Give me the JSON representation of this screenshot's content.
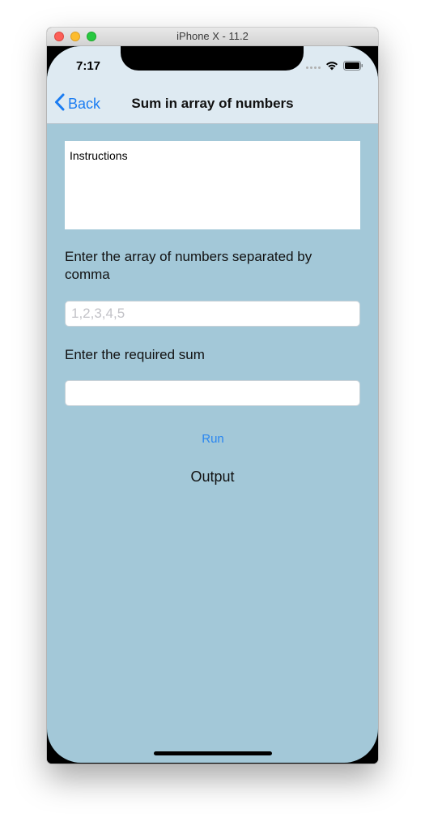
{
  "window": {
    "title": "iPhone X - 11.2"
  },
  "status_bar": {
    "time": "7:17"
  },
  "nav": {
    "back_label": "Back",
    "title": "Sum in array of numbers"
  },
  "instructions": {
    "text": "Instructions"
  },
  "array_input": {
    "label": "Enter the array of numbers separated by comma",
    "value": "",
    "placeholder": "1,2,3,4,5"
  },
  "sum_input": {
    "label": "Enter the required sum",
    "value": "",
    "placeholder": ""
  },
  "run_button": {
    "label": "Run"
  },
  "output": {
    "text": "Output"
  },
  "colors": {
    "background": "#a3c8d8",
    "nav_bar": "#deeaf2",
    "accent": "#1a7cf2"
  },
  "icons": {
    "back": "chevron-left-icon",
    "wifi": "wifi-icon",
    "battery": "battery-icon",
    "signal": "cellular-signal-icon"
  }
}
